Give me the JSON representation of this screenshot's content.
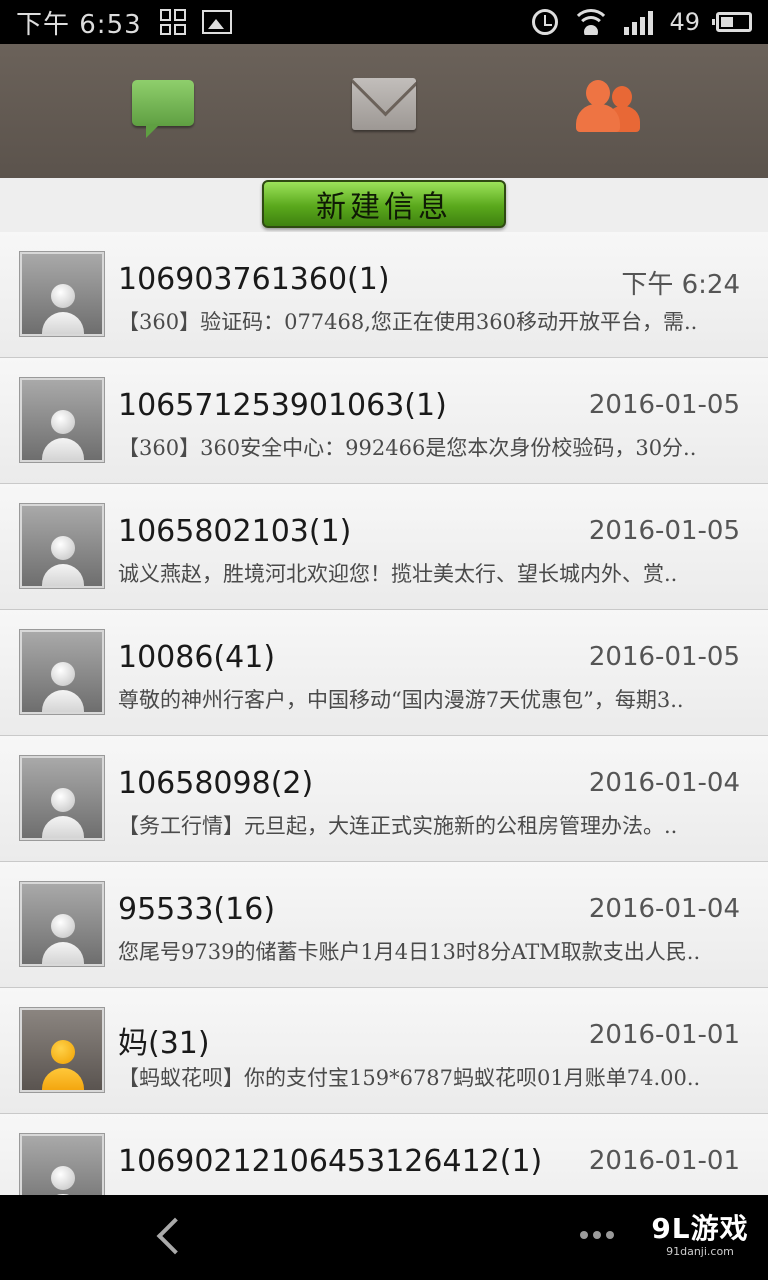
{
  "status_bar": {
    "time": "下午 6:53",
    "battery": "49"
  },
  "new_message_label": "新建信息",
  "conversations": [
    {
      "name": "106903761360(1)",
      "date": "下午 6:24",
      "preview": "【360】验证码：077468,您正在使用360移动开放平台，需..",
      "avatar": "default"
    },
    {
      "name": "106571253901063(1)",
      "date": "2016-01-05",
      "preview": "【360】360安全中心：992466是您本次身份校验码，30分..",
      "avatar": "default"
    },
    {
      "name": "1065802103(1)",
      "date": "2016-01-05",
      "preview": "诚义燕赵，胜境河北欢迎您！揽壮美太行、望长城内外、赏..",
      "avatar": "default"
    },
    {
      "name": "10086(41)",
      "date": "2016-01-05",
      "preview": "尊敬的神州行客户，中国移动“国内漫游7天优惠包”，每期3..",
      "avatar": "default"
    },
    {
      "name": "10658098(2)",
      "date": "2016-01-04",
      "preview": "【务工行情】元旦起，大连正式实施新的公租房管理办法。..",
      "avatar": "default"
    },
    {
      "name": "95533(16)",
      "date": "2016-01-04",
      "preview": "您尾号9739的储蓄卡账户1月4日13时8分ATM取款支出人民..",
      "avatar": "default"
    },
    {
      "name": "妈(31)",
      "date": "2016-01-01",
      "preview": "【蚂蚁花呗】你的支付宝159*6787蚂蚁花呗01月账单74.00..",
      "avatar": "contact"
    },
    {
      "name": "10690212106453126412(1)",
      "date": "2016-01-01",
      "preview": "",
      "avatar": "default"
    }
  ],
  "watermark": {
    "logo": "9L游戏",
    "site": "91danji.com"
  }
}
